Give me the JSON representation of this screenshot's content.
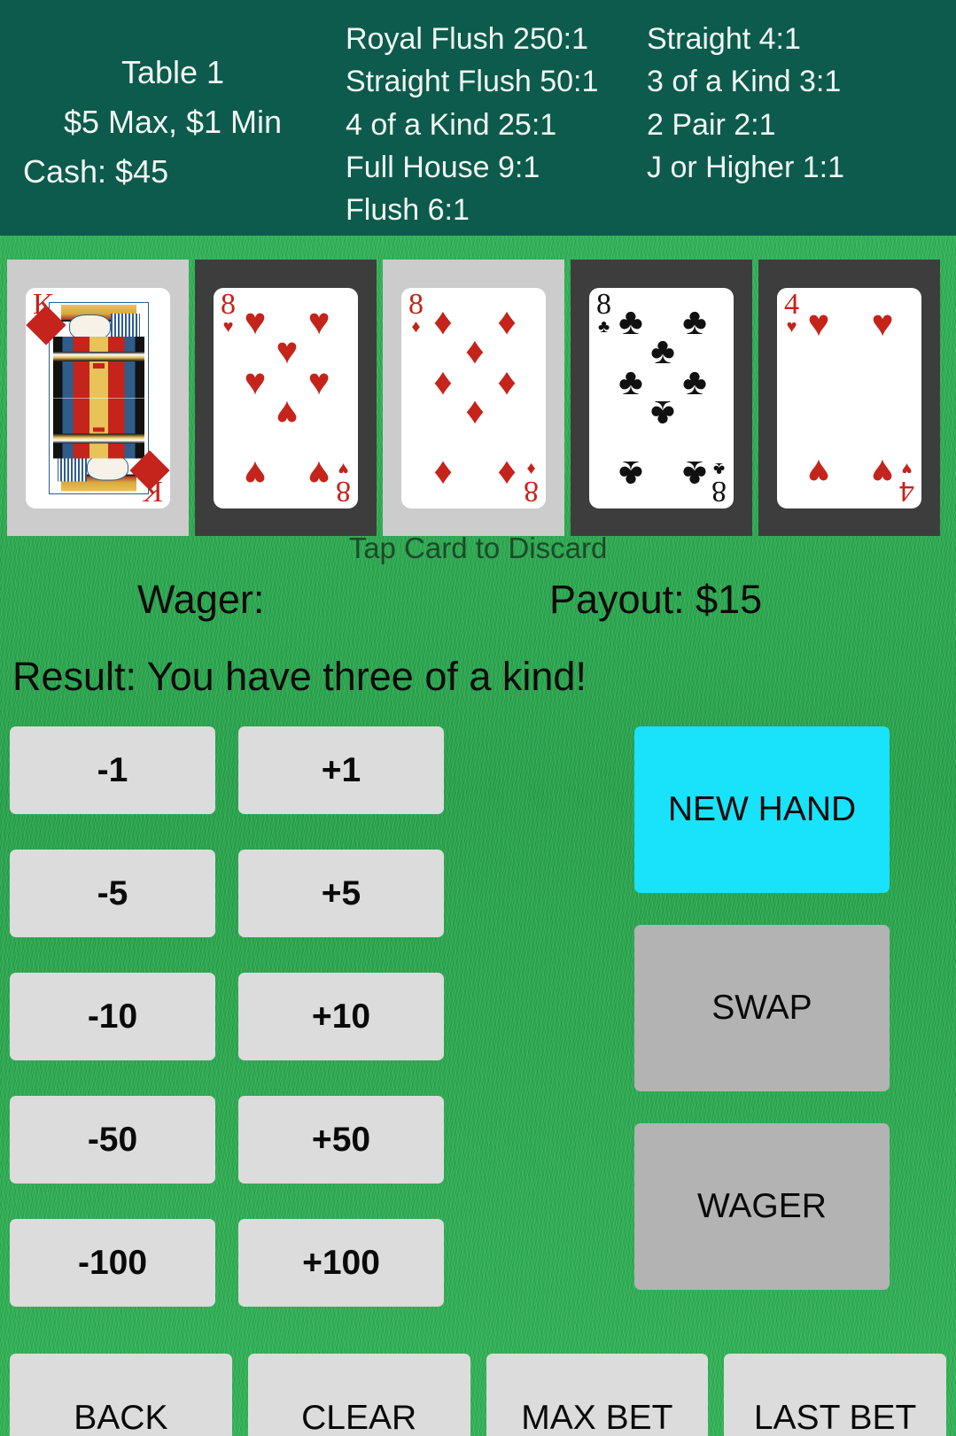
{
  "header": {
    "table_name": "Table 1",
    "limits": "$5 Max, $1 Min",
    "cash": "Cash: $45",
    "payout_column_1": [
      "Royal Flush 250:1",
      "Straight Flush 50:1",
      "4 of a Kind 25:1",
      "Full House 9:1",
      "Flush 6:1"
    ],
    "payout_column_2": [
      "Straight 4:1",
      "3 of a Kind 3:1",
      "2 Pair 2:1",
      "J or Higher 1:1"
    ]
  },
  "hand": {
    "discard_hint": "Tap Card to Discard",
    "cards": [
      {
        "rank": "K",
        "suit": "♦",
        "suit_name": "diamonds",
        "color": "red",
        "value": 13,
        "selected": false,
        "face": true
      },
      {
        "rank": "8",
        "suit": "♥",
        "suit_name": "hearts",
        "color": "red",
        "value": 8,
        "selected": true,
        "face": false
      },
      {
        "rank": "8",
        "suit": "♦",
        "suit_name": "diamonds",
        "color": "red",
        "value": 8,
        "selected": false,
        "face": false
      },
      {
        "rank": "8",
        "suit": "♣",
        "suit_name": "clubs",
        "color": "black",
        "value": 8,
        "selected": true,
        "face": false
      },
      {
        "rank": "4",
        "suit": "♥",
        "suit_name": "hearts",
        "color": "red",
        "value": 4,
        "selected": true,
        "face": false
      }
    ]
  },
  "status": {
    "wager_label": "Wager:",
    "wager_value": "",
    "payout_label": "Payout: $15",
    "result_label": "Result: You have three of a kind!"
  },
  "bet_buttons": [
    {
      "label": "-1"
    },
    {
      "label": "+1"
    },
    {
      "label": "-5"
    },
    {
      "label": "+5"
    },
    {
      "label": "-10"
    },
    {
      "label": "+10"
    },
    {
      "label": "-50"
    },
    {
      "label": "+50"
    },
    {
      "label": "-100"
    },
    {
      "label": "+100"
    }
  ],
  "action_buttons": [
    {
      "label": "NEW HAND",
      "style": "accent"
    },
    {
      "label": "SWAP",
      "style": "plain"
    },
    {
      "label": "WAGER",
      "style": "plain"
    }
  ],
  "bottom_buttons": [
    {
      "label": "BACK"
    },
    {
      "label": "CLEAR"
    },
    {
      "label": "MAX BET"
    },
    {
      "label": "LAST BET"
    }
  ],
  "colors": {
    "header_bg": "#0c5b4c",
    "felt_green": "#29ab4f",
    "card_slot_idle": "#cccccc",
    "card_slot_selected": "#3d3d3d",
    "bet_button": "#dcdcdc",
    "action_accent": "#18e3fb",
    "action_plain": "#b3b3b3",
    "suit_red": "#c4241b",
    "suit_black": "#111111"
  }
}
